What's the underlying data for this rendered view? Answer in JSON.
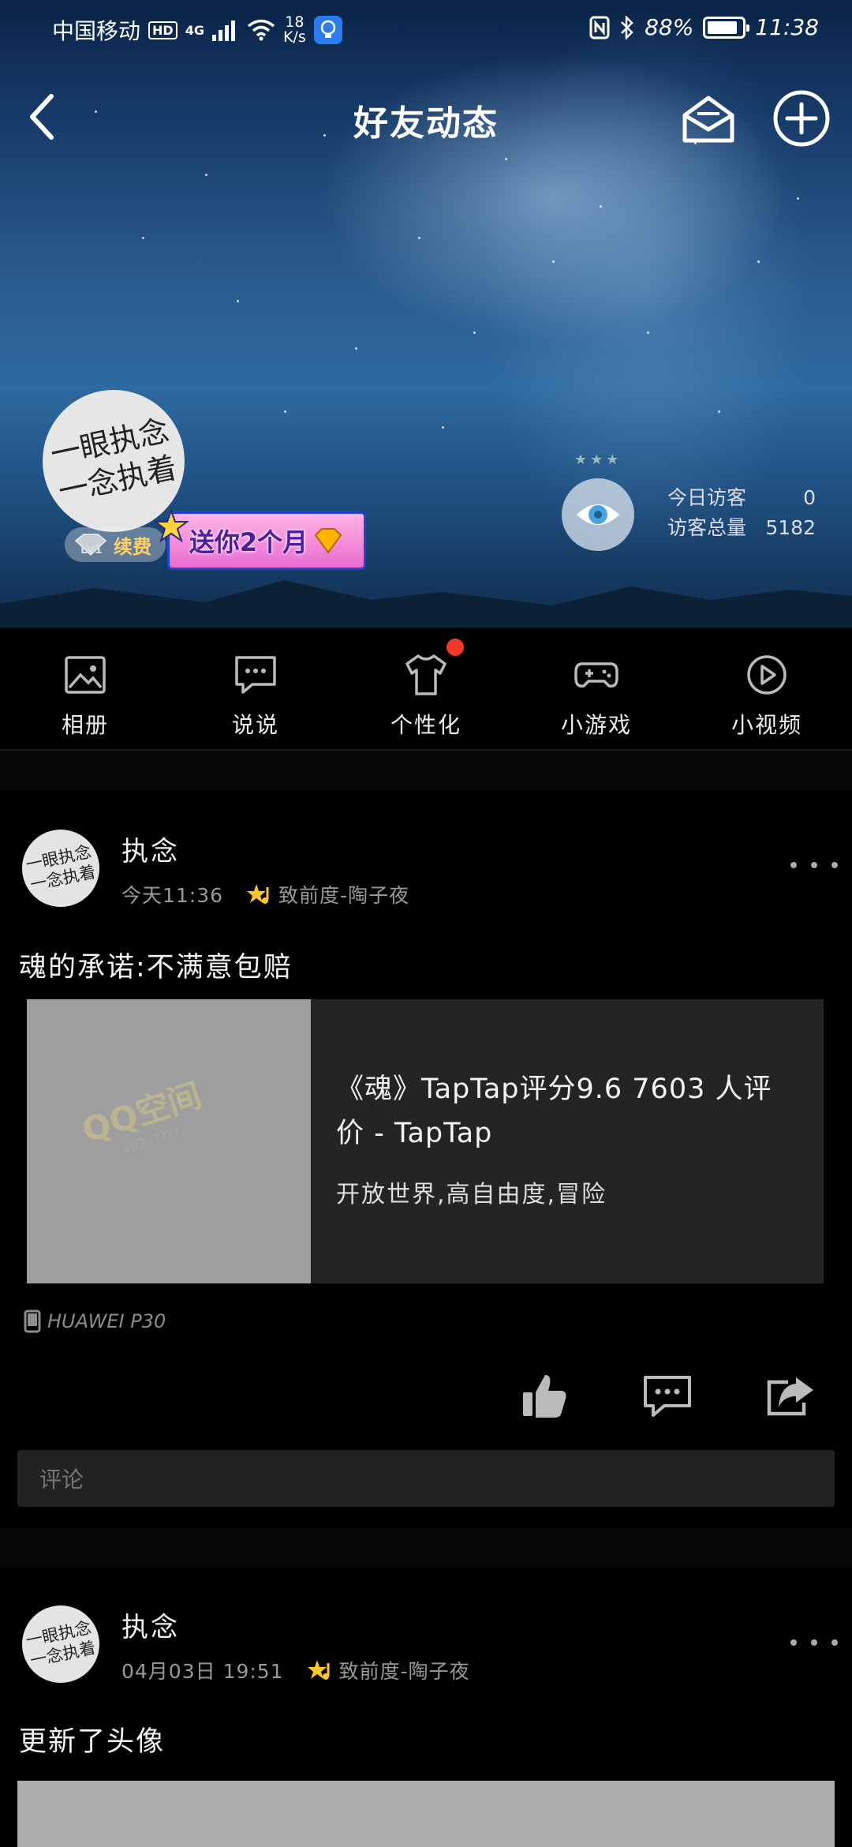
{
  "status_bar": {
    "carrier": "中国移动",
    "hd": "HD",
    "signal_type": "4G",
    "speed_value": "18",
    "speed_unit": "K/s",
    "battery": "88%",
    "battery_level": 0.88,
    "time": "11:38"
  },
  "nav": {
    "title": "好友动态"
  },
  "profile": {
    "avatar_text_line1": "一眼执念",
    "avatar_text_line2": "一念执着",
    "level": "LV1",
    "renew_label": "续费",
    "gift_label": "送你2个月",
    "visitors_today_label": "今日访客",
    "visitors_today_value": "0",
    "visitors_total_label": "访客总量",
    "visitors_total_value": "5182"
  },
  "shortcuts": [
    {
      "label": "相册",
      "icon": "photo-icon"
    },
    {
      "label": "说说",
      "icon": "chat-icon"
    },
    {
      "label": "个性化",
      "icon": "shirt-icon",
      "badge": true
    },
    {
      "label": "小游戏",
      "icon": "gamepad-icon"
    },
    {
      "label": "小视频",
      "icon": "play-icon"
    }
  ],
  "posts": [
    {
      "author": "执念",
      "time": "今天11:36",
      "song": "致前度-陶子夜",
      "text": "魂的承诺:不满意包赔",
      "link_title": "《魂》TapTap评分9.6 7603 人评价 - TapTap",
      "link_desc": "开放世界,高自由度,冒险",
      "watermark": "QQ空间",
      "device": "HUAWEI P30",
      "comment_placeholder": "评论"
    },
    {
      "author": "执念",
      "time": "04月03日 19:51",
      "song": "致前度-陶子夜",
      "text": "更新了头像"
    }
  ],
  "colors": {
    "background": "#000000",
    "card": "#242424",
    "badge_red": "#f0392b",
    "meta_gray": "#999999"
  }
}
